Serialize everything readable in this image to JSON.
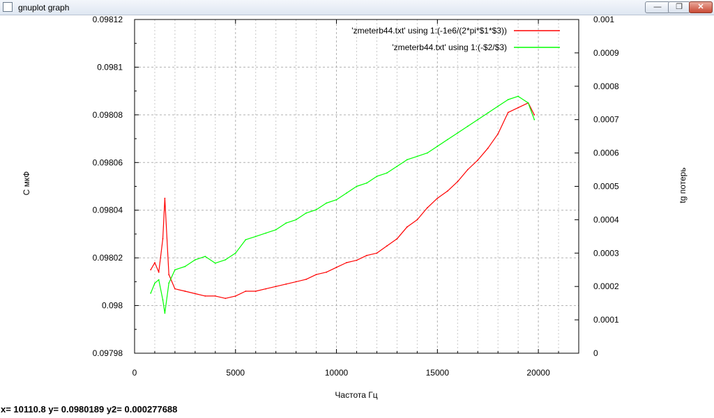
{
  "window": {
    "title": "gnuplot graph",
    "minimize_icon": "minimize-icon",
    "maximize_icon": "restore-icon",
    "close_icon": "close-icon"
  },
  "status": {
    "text": "x= 10110.8 y= 0.0980189 y2= 0.000277688"
  },
  "chart_data": {
    "type": "line",
    "title": "",
    "xlabel": "Частота Гц",
    "ylabel": "С мкФ",
    "y2label": "tg потерь",
    "xlim": [
      0,
      22000
    ],
    "ylim": [
      0.09798,
      0.09812
    ],
    "y2lim": [
      0,
      0.001
    ],
    "x_ticks": [
      "0",
      "5000",
      "10000",
      "15000",
      "20000"
    ],
    "x_tick_values": [
      0,
      5000,
      10000,
      15000,
      20000
    ],
    "y_ticks": [
      "0.09798",
      "0.098",
      "0.09802",
      "0.09804",
      "0.09806",
      "0.09808",
      "0.0981",
      "0.09812"
    ],
    "y_tick_values": [
      0.09798,
      0.098,
      0.09802,
      0.09804,
      0.09806,
      0.09808,
      0.0981,
      0.09812
    ],
    "y2_ticks": [
      "0",
      "0.0001",
      "0.0002",
      "0.0003",
      "0.0004",
      "0.0005",
      "0.0006",
      "0.0007",
      "0.0008",
      "0.0009",
      "0.001"
    ],
    "y2_tick_values": [
      0,
      0.0001,
      0.0002,
      0.0003,
      0.0004,
      0.0005,
      0.0006,
      0.0007,
      0.0008,
      0.0009,
      0.001
    ],
    "grid": true,
    "legend_position": "top-right",
    "series": [
      {
        "name": "'zmeterb44.txt' using 1:(-1e6/(2*pi*$1*$3))",
        "color": "#ff0000",
        "axis": "y",
        "x": [
          800,
          1000,
          1200,
          1400,
          1500,
          1700,
          2000,
          2500,
          3000,
          3500,
          4000,
          4500,
          5000,
          5500,
          6000,
          6500,
          7000,
          7500,
          8000,
          8500,
          9000,
          9500,
          10000,
          10500,
          11000,
          11500,
          12000,
          12500,
          13000,
          13500,
          14000,
          14500,
          15000,
          15500,
          16000,
          16500,
          17000,
          17500,
          18000,
          18500,
          19000,
          19500,
          19800
        ],
        "values": [
          0.098015,
          0.098018,
          0.098014,
          0.098028,
          0.098045,
          0.098013,
          0.098007,
          0.098006,
          0.098005,
          0.098004,
          0.098004,
          0.098003,
          0.098004,
          0.098006,
          0.098006,
          0.098007,
          0.098008,
          0.098009,
          0.09801,
          0.098011,
          0.098013,
          0.098014,
          0.098016,
          0.098018,
          0.098019,
          0.098021,
          0.098022,
          0.098025,
          0.098028,
          0.098033,
          0.098036,
          0.098041,
          0.098045,
          0.098048,
          0.098052,
          0.098057,
          0.098061,
          0.098066,
          0.098072,
          0.098081,
          0.098083,
          0.098085,
          0.09808
        ]
      },
      {
        "name": "'zmeterb44.txt' using 1:(-$2/$3)",
        "color": "#00ff00",
        "axis": "y2",
        "x": [
          800,
          1000,
          1200,
          1400,
          1500,
          1700,
          2000,
          2500,
          3000,
          3500,
          4000,
          4500,
          5000,
          5500,
          6000,
          6500,
          7000,
          7500,
          8000,
          8500,
          9000,
          9500,
          10000,
          10500,
          11000,
          11500,
          12000,
          12500,
          13000,
          13500,
          14000,
          14500,
          15000,
          15500,
          16000,
          16500,
          17000,
          17500,
          18000,
          18500,
          19000,
          19500,
          19800
        ],
        "values": [
          0.00018,
          0.00021,
          0.00022,
          0.00016,
          0.00012,
          0.00021,
          0.00025,
          0.00026,
          0.00028,
          0.00029,
          0.00027,
          0.00028,
          0.0003,
          0.00034,
          0.00035,
          0.00036,
          0.00037,
          0.00039,
          0.0004,
          0.00042,
          0.00043,
          0.00045,
          0.00046,
          0.00048,
          0.0005,
          0.00051,
          0.00053,
          0.00054,
          0.00056,
          0.00058,
          0.00059,
          0.0006,
          0.00062,
          0.00064,
          0.00066,
          0.00068,
          0.0007,
          0.00072,
          0.00074,
          0.00076,
          0.00077,
          0.00075,
          0.0007
        ]
      }
    ]
  }
}
